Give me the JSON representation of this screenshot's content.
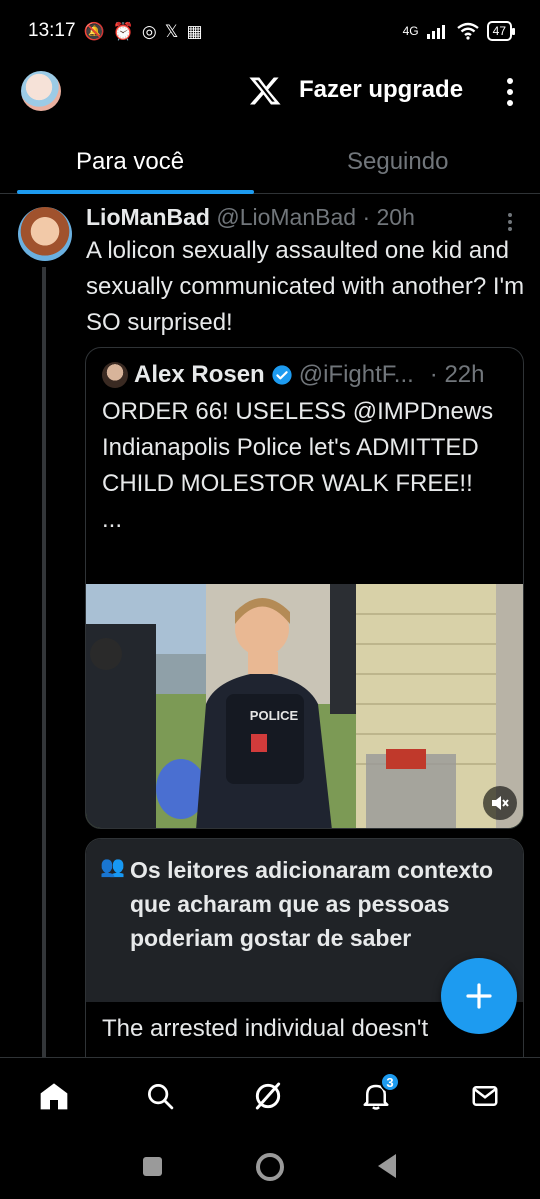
{
  "status_bar": {
    "time": "13:17",
    "network": "4G",
    "battery": "47"
  },
  "header": {
    "upgrade_label": "Fazer upgrade"
  },
  "tabs": [
    {
      "label": "Para você",
      "active": true
    },
    {
      "label": "Seguindo",
      "active": false
    }
  ],
  "post": {
    "author_name": "LioManBad",
    "author_handle": "@LioManBad",
    "time": "20h",
    "text": "A lolicon sexually assaulted one kid and sexually communicated with another? I'm SO surprised!",
    "quote": {
      "author_name": "Alex Rosen",
      "author_handle": "@iFightF...",
      "time": "22h",
      "text": "ORDER 66! USELESS @IMPDnews Indianapolis Police let's ADMITTED CHILD MOLESTOR WALK FREE!!",
      "ellipsis": "...",
      "media_label": "POLICE"
    },
    "community_note": {
      "title": "Os leitores adicionaram contexto que acharam que as pessoas poderiam gostar de saber",
      "body": "The arrested individual doesn't"
    }
  },
  "bottom_nav": {
    "notifications_badge": "3"
  },
  "colors": {
    "accent": "#1d9bf0",
    "background": "#000000",
    "muted_text": "#71767b",
    "divider": "#2f3336"
  }
}
